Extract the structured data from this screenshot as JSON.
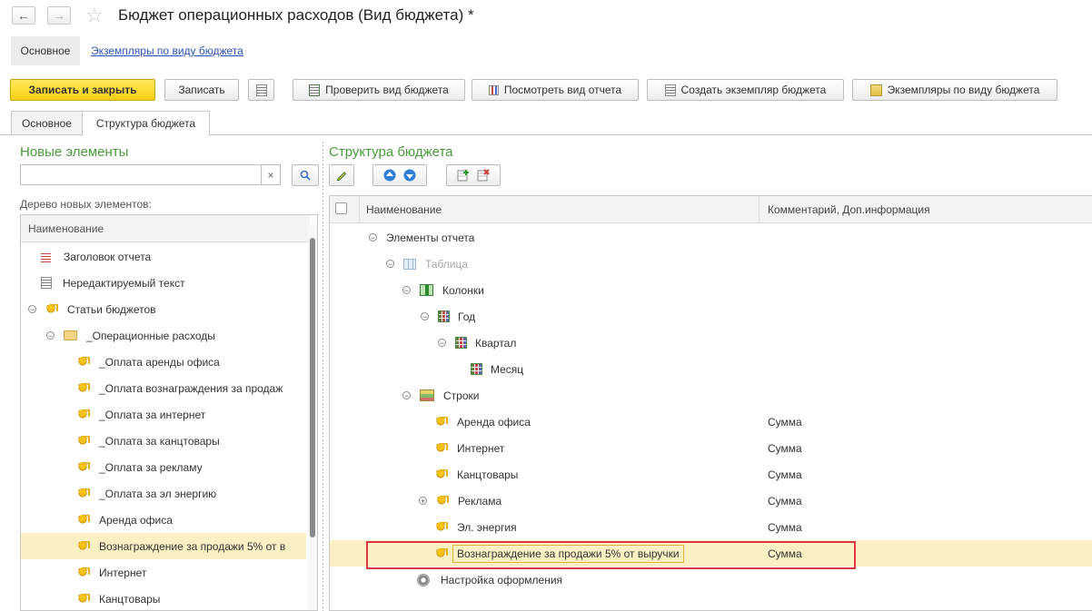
{
  "window": {
    "title": "Бюджет операционных расходов  (Вид бюджета) *"
  },
  "nav": {
    "back": "←",
    "forward": "→",
    "favorite": "☆"
  },
  "top_tabs": {
    "main": "Основное",
    "instances_link": "Экземпляры по виду бюджета"
  },
  "toolbar": {
    "save_close": "Записать и закрыть",
    "save": "Записать",
    "check": "Проверить вид бюджета",
    "view_report": "Посмотреть вид отчета",
    "create_instance": "Создать экземпляр бюджета",
    "instances": "Экземпляры по виду бюджета"
  },
  "form_tabs": [
    "Основное",
    "Структура бюджета"
  ],
  "left": {
    "title": "Новые элементы",
    "search_value": "",
    "clear": "×",
    "tree_label": "Дерево новых элементов:",
    "column": "Наименование",
    "items": [
      {
        "label": "Заголовок отчета",
        "icon": "report-header-icon"
      },
      {
        "label": "Нередактируемый текст",
        "icon": "text-icon"
      },
      {
        "label": "Статьи бюджетов",
        "icon": "coins-icon",
        "expander": "−"
      },
      {
        "label": "_Операционные расходы",
        "icon": "folder-icon",
        "expander": "−"
      },
      {
        "label": "_Оплата аренды офиса",
        "icon": "coins-icon"
      },
      {
        "label": "_Оплата вознаграждения  за продаж",
        "icon": "coins-icon"
      },
      {
        "label": "_Оплата за интернет",
        "icon": "coins-icon"
      },
      {
        "label": "_Оплата за канцтовары",
        "icon": "coins-icon"
      },
      {
        "label": "_Оплата за рекламу",
        "icon": "coins-icon"
      },
      {
        "label": "_Оплата за эл энергию",
        "icon": "coins-icon"
      },
      {
        "label": "Аренда офиса",
        "icon": "coins-icon"
      },
      {
        "label": "Вознаграждение  за продажи 5% от в",
        "icon": "coins-icon",
        "selected": true
      },
      {
        "label": "Интернет",
        "icon": "coins-icon"
      },
      {
        "label": "Канцтовары",
        "icon": "coins-icon"
      }
    ]
  },
  "right": {
    "title": "Структура бюджета",
    "columns": [
      "Наименование",
      "Комментарий, Доп.информация"
    ],
    "rows": [
      {
        "label": "Элементы отчета",
        "comment": "",
        "expander": "−",
        "icon": ""
      },
      {
        "label": "Таблица",
        "comment": "",
        "expander": "−",
        "icon": "table-icon",
        "muted": true
      },
      {
        "label": "Колонки",
        "comment": "",
        "expander": "−",
        "icon": "columns-icon"
      },
      {
        "label": "Год",
        "comment": "",
        "expander": "−",
        "icon": "grid-icon"
      },
      {
        "label": "Квартал",
        "comment": "",
        "expander": "−",
        "icon": "grid-icon"
      },
      {
        "label": "Месяц",
        "comment": "",
        "expander": "",
        "icon": "grid-icon"
      },
      {
        "label": "Строки",
        "comment": "",
        "expander": "−",
        "icon": "rows-icon"
      },
      {
        "label": "Аренда офиса",
        "comment": "Сумма",
        "expander": "",
        "icon": "coins-icon"
      },
      {
        "label": "Интернет",
        "comment": "Сумма",
        "expander": "",
        "icon": "coins-icon"
      },
      {
        "label": "Канцтовары",
        "comment": "Сумма",
        "expander": "",
        "icon": "coins-icon"
      },
      {
        "label": "Реклама",
        "comment": "Сумма",
        "expander": "+",
        "icon": "coins-icon"
      },
      {
        "label": "Эл. энергия",
        "comment": "Сумма",
        "expander": "",
        "icon": "coins-icon"
      },
      {
        "label": "Вознаграждение  за продажи 5% от выручки",
        "comment": "Сумма",
        "expander": "",
        "icon": "coins-icon",
        "selected": true
      },
      {
        "label": "Настройка оформления",
        "comment": "",
        "expander": "",
        "icon": "gear-icon"
      }
    ]
  },
  "colors": {
    "accent_green": "#4a9a3c",
    "selection": "#fbf0c4",
    "highlight_frame": "#d9363e",
    "primary_button": "#f6cf12"
  }
}
